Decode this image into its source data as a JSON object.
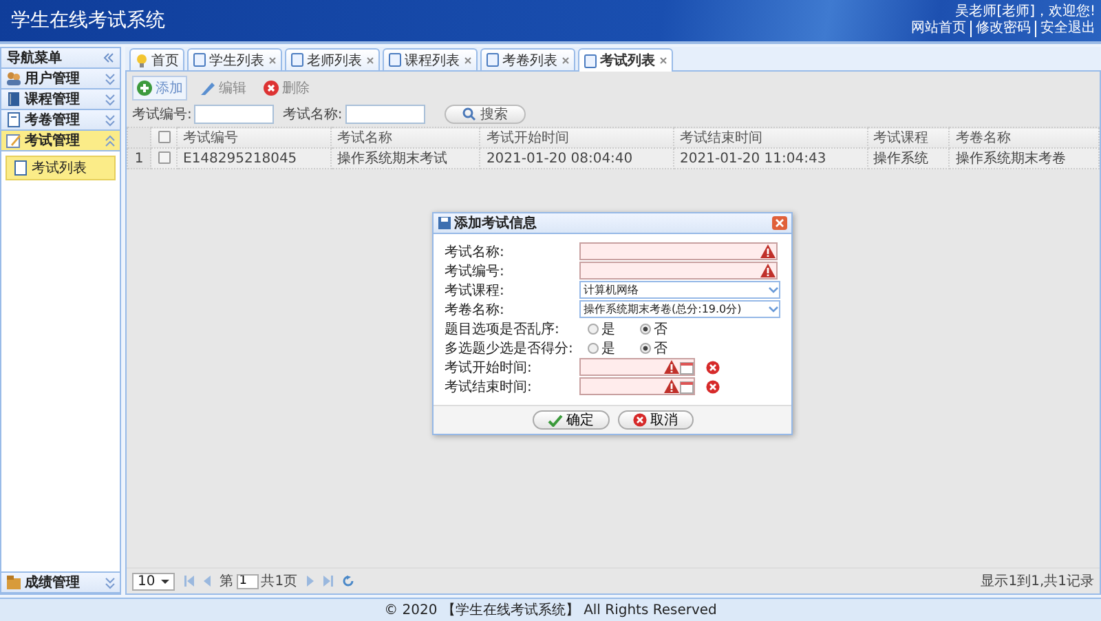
{
  "header": {
    "title": "学生在线考试系统",
    "greeting": "吴老师[老师]，欢迎您!",
    "links": [
      "网站首页",
      "修改密码",
      "安全退出"
    ]
  },
  "sidebar": {
    "title": "导航菜单",
    "groups": [
      {
        "label": "用户管理",
        "kind": "users",
        "expanded": false
      },
      {
        "label": "课程管理",
        "kind": "book",
        "expanded": false
      },
      {
        "label": "考卷管理",
        "kind": "paper",
        "expanded": false
      },
      {
        "label": "考试管理",
        "kind": "pen",
        "expanded": true,
        "children": [
          {
            "label": "考试列表",
            "selected": true
          }
        ]
      },
      {
        "label": "成绩管理",
        "kind": "folder",
        "expanded": false
      }
    ]
  },
  "tabs": [
    {
      "label": "首页",
      "kind": "home",
      "closable": false,
      "selected": false
    },
    {
      "label": "学生列表",
      "kind": "page",
      "closable": true,
      "selected": false
    },
    {
      "label": "老师列表",
      "kind": "page",
      "closable": true,
      "selected": false
    },
    {
      "label": "课程列表",
      "kind": "page",
      "closable": true,
      "selected": false
    },
    {
      "label": "考卷列表",
      "kind": "page",
      "closable": true,
      "selected": false
    },
    {
      "label": "考试列表",
      "kind": "page",
      "closable": true,
      "selected": true
    }
  ],
  "toolbar": [
    {
      "label": "添加",
      "kind": "add"
    },
    {
      "label": "编辑",
      "kind": "edit"
    },
    {
      "label": "删除",
      "kind": "delete"
    }
  ],
  "search": {
    "fields": [
      {
        "label": "考试编号:"
      },
      {
        "label": "考试名称:"
      }
    ],
    "button": "搜索"
  },
  "table": {
    "all_checked": false,
    "columns": [
      "考试编号",
      "考试名称",
      "考试开始时间",
      "考试结束时间",
      "考试课程",
      "考卷名称"
    ],
    "rows": [
      {
        "number": "1",
        "checked": false,
        "cells": [
          "E148295218045",
          "操作系统期末考试",
          "2021-01-20 08:04:40",
          "2021-01-20 11:04:43",
          "操作系统",
          "操作系统期末考卷"
        ]
      }
    ]
  },
  "pager": {
    "page_size": "10",
    "before": "第",
    "page": "1",
    "after": "共1页",
    "summary": "显示1到1,共1记录"
  },
  "dialog": {
    "title": "添加考试信息",
    "fields": [
      {
        "kind": "text",
        "label": "考试名称:",
        "required": true
      },
      {
        "kind": "text",
        "label": "考试编号:",
        "required": true
      },
      {
        "kind": "select",
        "label": "考试课程:",
        "value": "计算机网络"
      },
      {
        "kind": "select",
        "label": "考卷名称:",
        "value": "操作系统期末考卷(总分:19.0分)"
      },
      {
        "kind": "radio",
        "label": "题目选项是否乱序:",
        "options": [
          {
            "label": "是",
            "selected": false
          },
          {
            "label": "否",
            "selected": true
          }
        ]
      },
      {
        "kind": "radio",
        "label": "多选题少选是否得分:",
        "options": [
          {
            "label": "是",
            "selected": false
          },
          {
            "label": "否",
            "selected": true
          }
        ]
      },
      {
        "kind": "datetime",
        "label": "考试开始时间:",
        "required": true
      },
      {
        "kind": "datetime",
        "label": "考试结束时间:",
        "required": true
      }
    ],
    "buttons": [
      {
        "label": "确定",
        "kind": "ok"
      },
      {
        "label": "取消",
        "kind": "cancel"
      }
    ]
  },
  "footer": "© 2020 【学生在线考试系统】 All Rights Reserved"
}
